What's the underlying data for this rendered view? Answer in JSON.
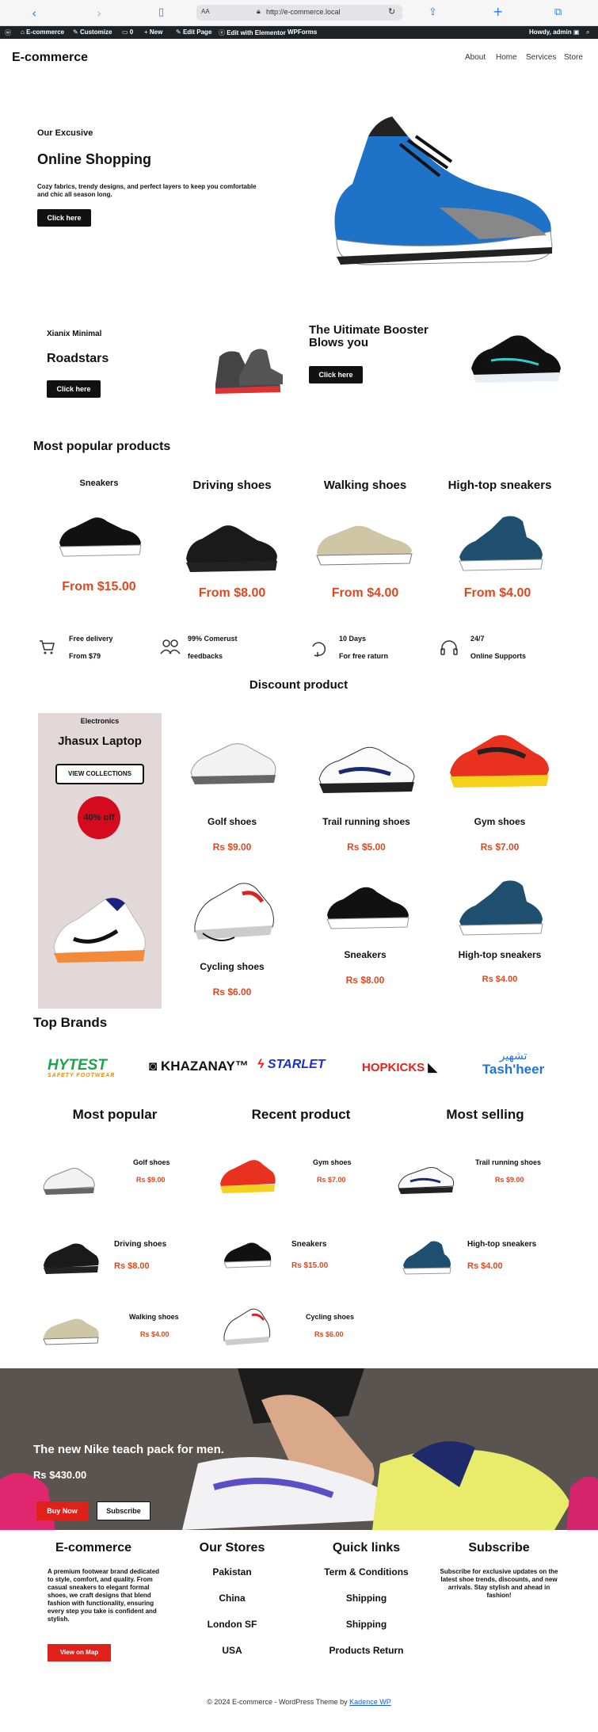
{
  "browser": {
    "aa": "AA",
    "url": "http://e-commerce.local"
  },
  "adminbar": {
    "site": "E-commerce",
    "customize": "Customize",
    "comments": "0",
    "new": "New",
    "edit_page": "Edit Page",
    "elementor": "Edit with Elementor",
    "wpforms": "WPForms",
    "howdy": "Howdy, admin"
  },
  "header": {
    "brand": "E-commerce",
    "nav": [
      "About",
      "Home",
      "Services",
      "Store"
    ]
  },
  "hero": {
    "eyebrow": "Our Excusive",
    "title": "Online Shopping",
    "desc": "Cozy fabrics, trendy designs, and perfect layers to keep you comfortable and chic all season long.",
    "button": "Click here"
  },
  "promo_left": {
    "eyebrow": "Xianix Minimal",
    "title": "Roadstars",
    "button": "Click here"
  },
  "promo_right": {
    "title": "The Uitimate Booster Blows you",
    "button": "Click here"
  },
  "popular": {
    "heading": "Most popular products",
    "items": [
      {
        "name": "Sneakers",
        "price": "From $15.00"
      },
      {
        "name": "Driving shoes",
        "price": "From $8.00"
      },
      {
        "name": "Walking shoes",
        "price": "From $4.00"
      },
      {
        "name": "High-top sneakers",
        "price": "From $4.00"
      }
    ]
  },
  "features": [
    {
      "title": "Free delivery",
      "sub": "From $79",
      "icon": "cart-icon"
    },
    {
      "title": "99% Comerust",
      "sub": "feedbacks",
      "icon": "users-icon"
    },
    {
      "title": "10 Days",
      "sub": "For free raturn",
      "icon": "return-icon"
    },
    {
      "title": "24/7",
      "sub": "Online Supports",
      "icon": "headset-icon"
    }
  ],
  "discount": {
    "heading": "Discount product",
    "side": {
      "eyebrow": "Electronics",
      "title": "Jhasux Laptop",
      "button": "VIEW COLLECTIONS",
      "badge": "40% off"
    },
    "items": [
      {
        "name": "Golf shoes",
        "price": "Rs $9.00"
      },
      {
        "name": "Trail running shoes",
        "price": "Rs $5.00"
      },
      {
        "name": "Gym shoes",
        "price": "Rs $7.00"
      },
      {
        "name": "Cycling shoes",
        "price": "Rs $6.00"
      },
      {
        "name": "Sneakers",
        "price": "Rs $8.00"
      },
      {
        "name": "High-top sneakers",
        "price": "Rs $4.00"
      }
    ]
  },
  "brands": {
    "heading": "Top Brands",
    "logos": [
      {
        "name": "HYTEST",
        "sub": "SAFETY FOOTWEAR"
      },
      {
        "name": "KHAZANAY™"
      },
      {
        "name": "STARLET"
      },
      {
        "name": "HOPKICKS"
      },
      {
        "name": "Tash'heer",
        "arabic": "تشهير"
      }
    ]
  },
  "lists": {
    "col1": {
      "heading": "Most popular",
      "items": [
        {
          "name": "Golf shoes",
          "price": "Rs $9.00"
        },
        {
          "name": "Driving shoes",
          "price": "Rs $8.00"
        },
        {
          "name": "Walking shoes",
          "price": "Rs $4.00"
        }
      ]
    },
    "col2": {
      "heading": "Recent product",
      "items": [
        {
          "name": "Gym shoes",
          "price": "Rs $7.00"
        },
        {
          "name": "Sneakers",
          "price": "Rs $15.00"
        },
        {
          "name": "Cycling shoes",
          "price": "Rs $6.00"
        }
      ]
    },
    "col3": {
      "heading": "Most selling",
      "items": [
        {
          "name": "Trail running shoes",
          "price": "Rs $9.00"
        },
        {
          "name": "High-top sneakers",
          "price": "Rs $4.00"
        }
      ]
    }
  },
  "banner": {
    "title": "The new Nike teach pack for men.",
    "price": "Rs $430.00",
    "buy": "Buy Now",
    "subscribe": "Subscribe"
  },
  "footer": {
    "brand": "E-commerce",
    "about": "A premium footwear brand dedicated to style, comfort, and quality. From casual sneakers to elegant formal shoes, we craft designs that blend fashion with functionality, ensuring every step you take is confident and stylish.",
    "map_button": "View on Map",
    "stores_heading": "Our Stores",
    "stores": [
      "Pakistan",
      "China",
      "London SF",
      "USA"
    ],
    "links_heading": "Quick links",
    "links": [
      "Term & Conditions",
      "Shipping",
      "Shipping",
      "Products Return"
    ],
    "subscribe_heading": "Subscribe",
    "subscribe_text": "Subscribe for exclusive updates on the latest shoe trends, discounts, and new arrivals. Stay stylish and ahead in fashion!",
    "copyright": "© 2024 E-commerce - WordPress Theme by",
    "theme_link": "Kadence WP"
  },
  "colors": {
    "accent": "#e0471c",
    "red_button": "#e0201b",
    "dark": "#111111",
    "discount_panel": "#e2d8d8"
  }
}
